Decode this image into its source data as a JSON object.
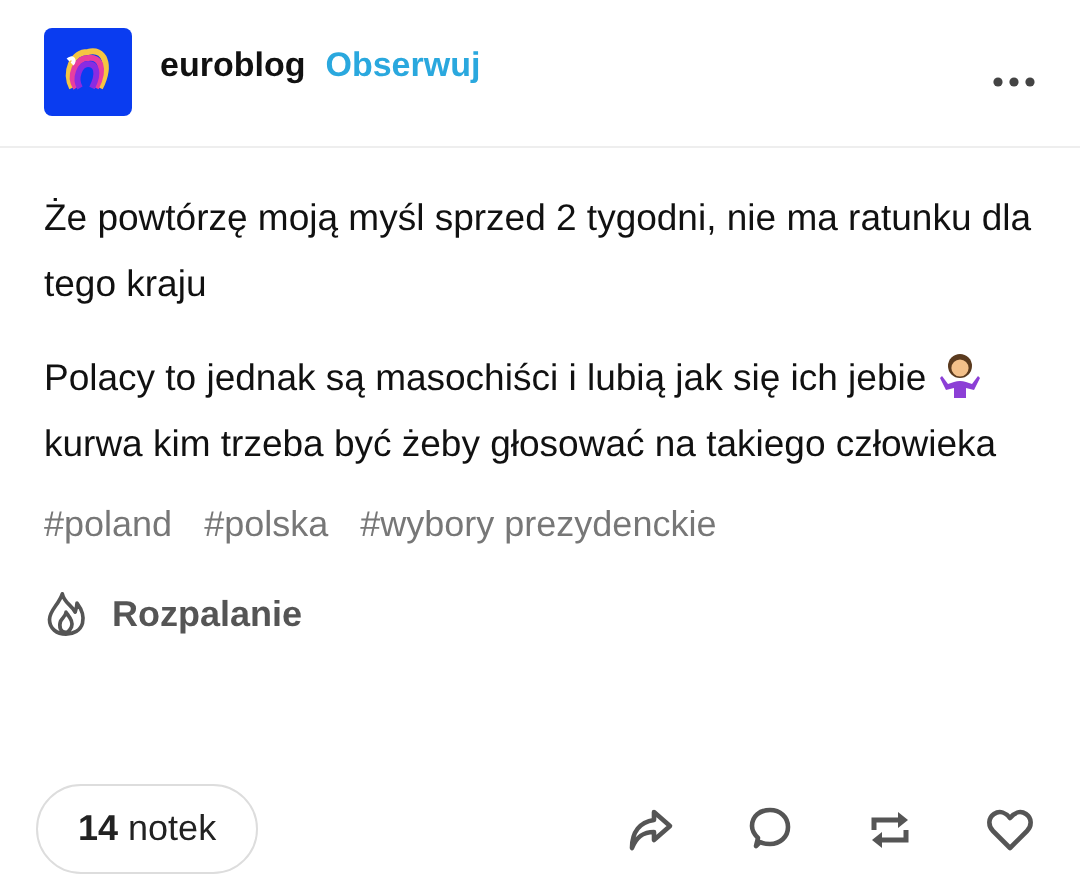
{
  "post": {
    "blog_name": "euroblog",
    "follow_label": "Obserwuj",
    "paragraphs": [
      {
        "parts": [
          {
            "kind": "text",
            "text": "Że powtórzę moją myśl sprzed 2 tygodni, nie ma ratunku dla tego kraju"
          }
        ]
      },
      {
        "parts": [
          {
            "kind": "text",
            "text": "Polacy to jednak są masochiści i lubią jak się ich jebie "
          },
          {
            "kind": "emoji"
          },
          {
            "kind": "text",
            "text": " kurwa kim trzeba być żeby głosować na takiego człowieka"
          }
        ]
      }
    ],
    "tags": [
      "#poland",
      "#polska",
      "#wybory prezydenckie"
    ],
    "trending_label": "Rozpalanie",
    "notes": {
      "count": "14",
      "label": "notek"
    }
  }
}
